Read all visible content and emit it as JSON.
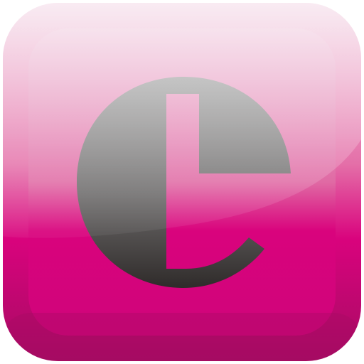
{
  "icon": {
    "name": "e-letter-app-icon",
    "brand_color": "#d9037d",
    "letter_color": "#3d3a39",
    "highlight_color": "#f2d8e6",
    "edge_color": "#a30b61"
  }
}
